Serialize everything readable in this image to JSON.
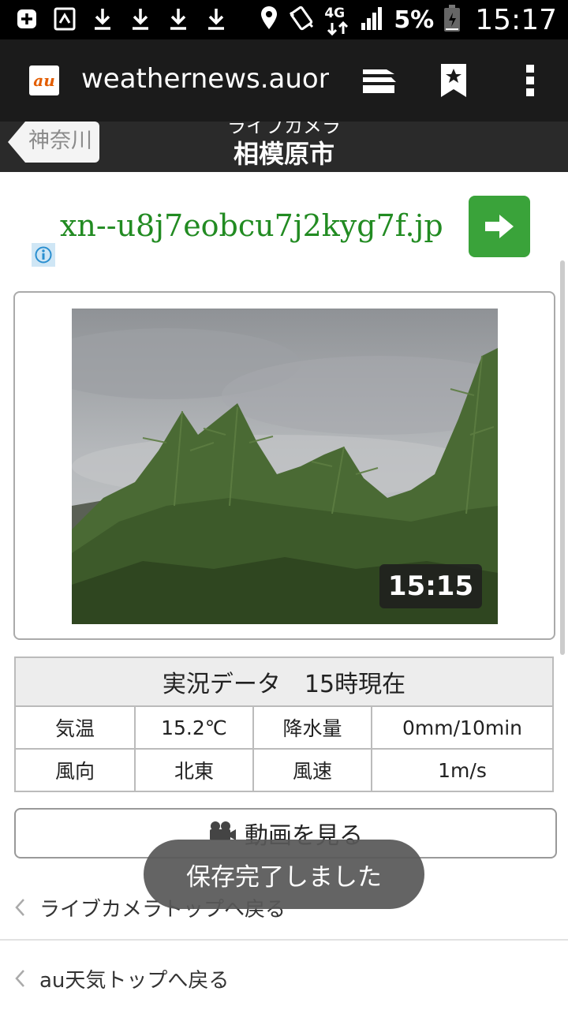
{
  "status_bar": {
    "battery_percent": "5%",
    "time": "15:17",
    "network": "4G"
  },
  "browser": {
    "url": "weathernews.auone",
    "logo_text": "au"
  },
  "header": {
    "back_label": "神奈川",
    "subtitle": "ライブカメラ",
    "title": "相模原市"
  },
  "ad": {
    "text": "xn--u8j7eobcu7j2kyg7f.jp"
  },
  "camera": {
    "timestamp": "15:15"
  },
  "data_table": {
    "header": "実況データ　15時現在",
    "rows": [
      [
        "気温",
        "15.2℃",
        "降水量",
        "0mm/10min"
      ],
      [
        "風向",
        "北東",
        "風速",
        "1m/s"
      ]
    ]
  },
  "video_button": {
    "label": "動画を見る"
  },
  "links": {
    "livecam_top": "ライブカメラトップへ戻る",
    "weather_top": "au天気トップへ戻る"
  },
  "toast": {
    "message": "保存完了しました"
  },
  "colors": {
    "ad_green": "#228b22",
    "ad_button": "#3aa33a",
    "header_bg": "#2a2a2a",
    "browser_bar_bg": "#1b1b1b"
  }
}
